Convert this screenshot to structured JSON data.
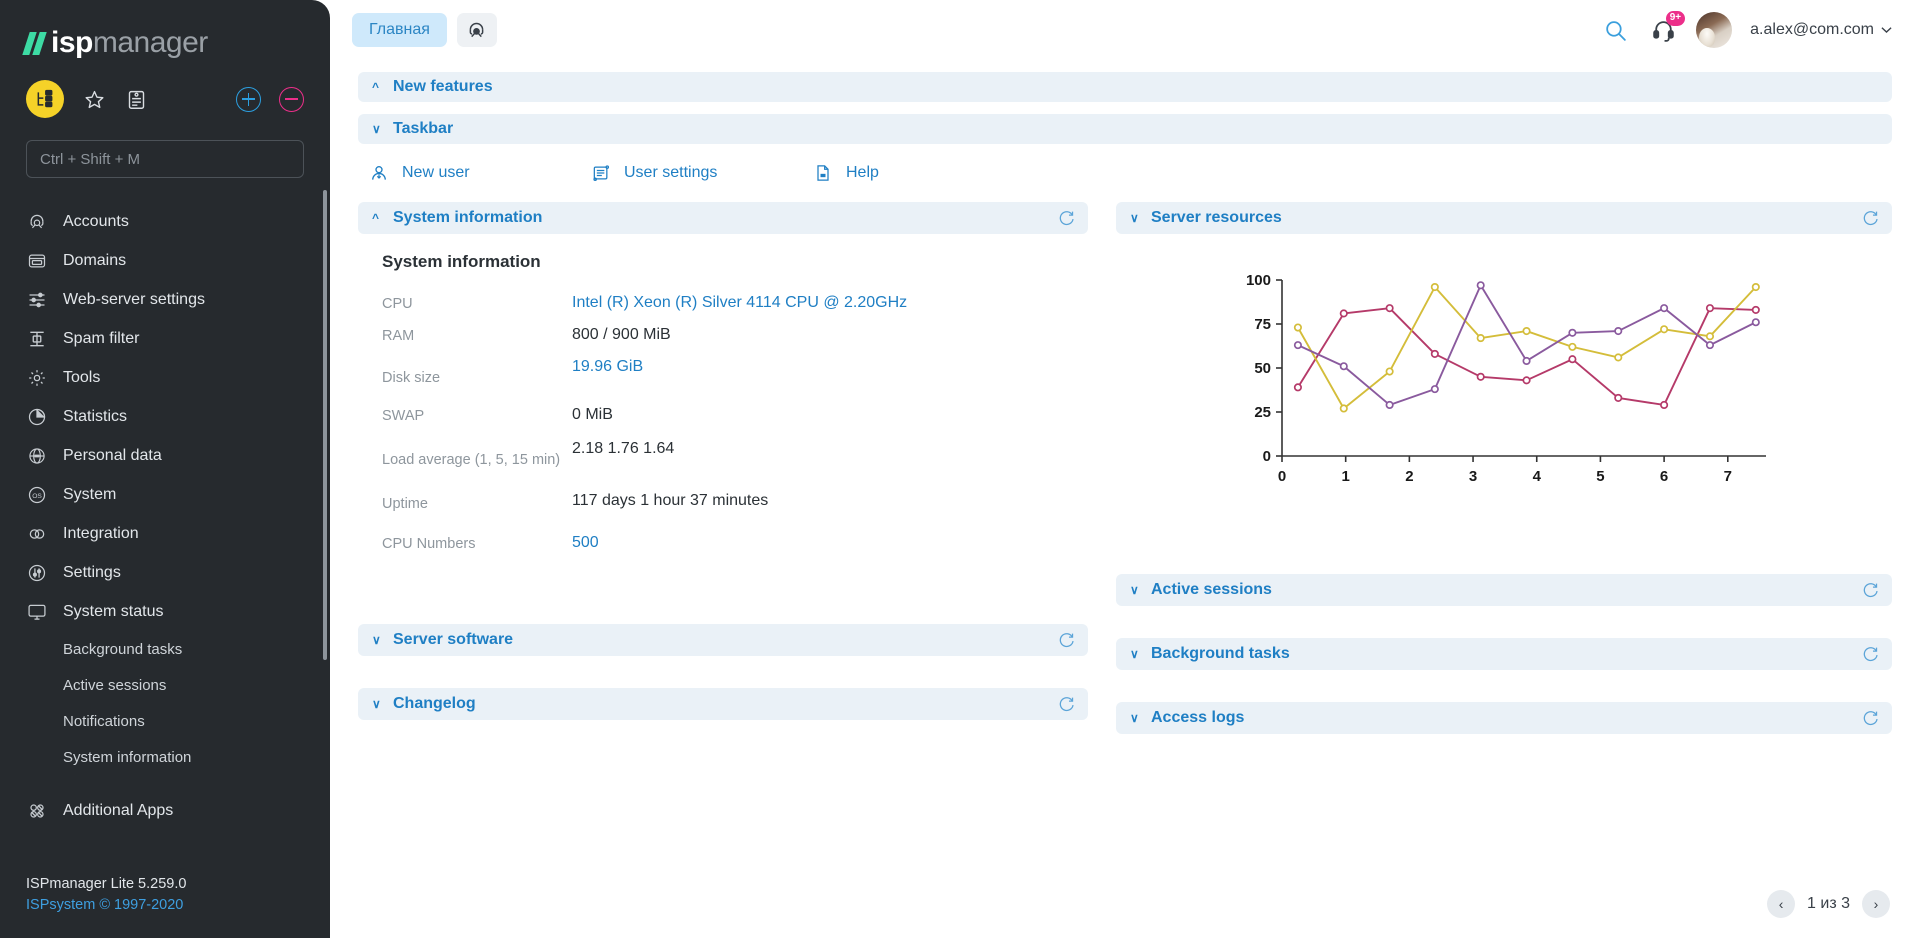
{
  "brand": {
    "logo_prefix": "isp",
    "logo_suffix": "manager"
  },
  "sidebar": {
    "search_placeholder": "Ctrl + Shift + M",
    "tools": [
      {
        "name": "structure-icon",
        "label": "Structure"
      },
      {
        "name": "star-icon",
        "label": "Favorites"
      },
      {
        "name": "clipboard-icon",
        "label": "Clipboard"
      },
      {
        "name": "plus-circle-icon",
        "label": "Add"
      },
      {
        "name": "minus-circle-icon",
        "label": "Remove"
      }
    ],
    "items": [
      {
        "label": "Accounts",
        "icon": "accounts-icon"
      },
      {
        "label": "Domains",
        "icon": "domains-icon"
      },
      {
        "label": "Web-server settings",
        "icon": "sliders-icon"
      },
      {
        "label": "Spam filter",
        "icon": "spam-filter-icon"
      },
      {
        "label": "Tools",
        "icon": "gear-icon"
      },
      {
        "label": "Statistics",
        "icon": "pie-chart-icon"
      },
      {
        "label": "Personal data",
        "icon": "personal-data-icon"
      },
      {
        "label": "System",
        "icon": "os-icon"
      },
      {
        "label": "Integration",
        "icon": "integration-icon"
      },
      {
        "label": "Settings",
        "icon": "settings-icon"
      },
      {
        "label": "System status",
        "icon": "monitor-icon"
      }
    ],
    "sub_items": [
      {
        "label": "Background tasks"
      },
      {
        "label": "Active sessions"
      },
      {
        "label": "Notifications"
      },
      {
        "label": "System information"
      }
    ],
    "additional_apps": {
      "label": "Additional Apps",
      "icon": "apps-icon"
    },
    "footer": {
      "version": "ISPmanager Lite 5.259.0",
      "copyright": "ISPsystem © 1997-2020"
    }
  },
  "topbar": {
    "tab_label": "Главная",
    "tab_icon_name": "accounts-icon",
    "search_icon": "search-icon",
    "support_icon": "headset-icon",
    "support_badge": "9+",
    "user_email": "a.alex@com.com",
    "chevron": "⌄"
  },
  "panels": {
    "new_features": {
      "title": "New features",
      "expanded": true
    },
    "taskbar": {
      "title": "Taskbar",
      "expanded": false
    },
    "system_information": {
      "title": "System information",
      "expanded": true
    },
    "server_software": {
      "title": "Server software",
      "expanded": false
    },
    "changelog": {
      "title": "Changelog",
      "expanded": false
    },
    "server_resources": {
      "title": "Server resources",
      "expanded": false
    },
    "active_sessions": {
      "title": "Active sessions",
      "expanded": false
    },
    "background_tasks": {
      "title": "Background tasks",
      "expanded": false
    },
    "access_logs": {
      "title": "Access logs",
      "expanded": false
    }
  },
  "taskbar_items": [
    {
      "label": "New user",
      "icon": "new-user-icon"
    },
    {
      "label": "User settings",
      "icon": "user-settings-icon"
    },
    {
      "label": "Help",
      "icon": "help-icon"
    }
  ],
  "system_information": {
    "heading": "System information",
    "rows": [
      {
        "label": "CPU",
        "value": "Intel (R) Xeon (R) Silver 4114 CPU @ 2.20GHz",
        "link": true
      },
      {
        "label": "RAM",
        "value": "800 / 900 MiB",
        "link": false
      },
      {
        "label": "Disk size",
        "value": "19.96 GiB",
        "link": true
      },
      {
        "label": "SWAP",
        "value": "0 MiB",
        "link": false
      },
      {
        "label": "Load average (1, 5, 15 min)",
        "value": "2.18 1.76 1.64",
        "link": false
      },
      {
        "label": "Uptime",
        "value": "117 days 1 hour 37 minutes",
        "link": false
      },
      {
        "label": "CPU Numbers",
        "value": "500",
        "link": true
      }
    ]
  },
  "pagination": {
    "label": "1 из 3",
    "prev": "‹",
    "next": "›"
  },
  "colors": {
    "accent_blue": "#1f7fc4",
    "panel_header_bg": "#eaf1f7",
    "sidebar_bg": "#262a2e",
    "brand_green": "#3ddba4",
    "brand_yellow": "#f5d228",
    "badge_pink": "#ec2f8a",
    "series_crimson": "#b53a69",
    "series_gold": "#d4bd3a",
    "series_purple": "#8a5a9e"
  },
  "chart_data": {
    "type": "line",
    "title": "Server resources",
    "xlabel": "",
    "ylabel": "",
    "xlim": [
      0,
      7.6
    ],
    "ylim": [
      0,
      100
    ],
    "yticks": [
      0,
      25,
      50,
      75,
      100
    ],
    "xticks": [
      0,
      1,
      2,
      3,
      4,
      5,
      6,
      7
    ],
    "grid": false,
    "legend": "none",
    "x": [
      0.25,
      0.97,
      1.69,
      2.4,
      3.12,
      3.84,
      4.56,
      5.28,
      6.0,
      6.72,
      7.44
    ],
    "series": [
      {
        "name": "series-crimson",
        "color": "#b53a69",
        "values": [
          39,
          81,
          84,
          58,
          45,
          43,
          55,
          33,
          29,
          84,
          83
        ]
      },
      {
        "name": "series-gold",
        "color": "#d4bd3a",
        "values": [
          73,
          27,
          48,
          96,
          67,
          71,
          62,
          56,
          72,
          68,
          96
        ]
      },
      {
        "name": "series-purple",
        "color": "#8a5a9e",
        "values": [
          63,
          51,
          29,
          38,
          97,
          54,
          70,
          71,
          84,
          63,
          76
        ]
      }
    ]
  }
}
